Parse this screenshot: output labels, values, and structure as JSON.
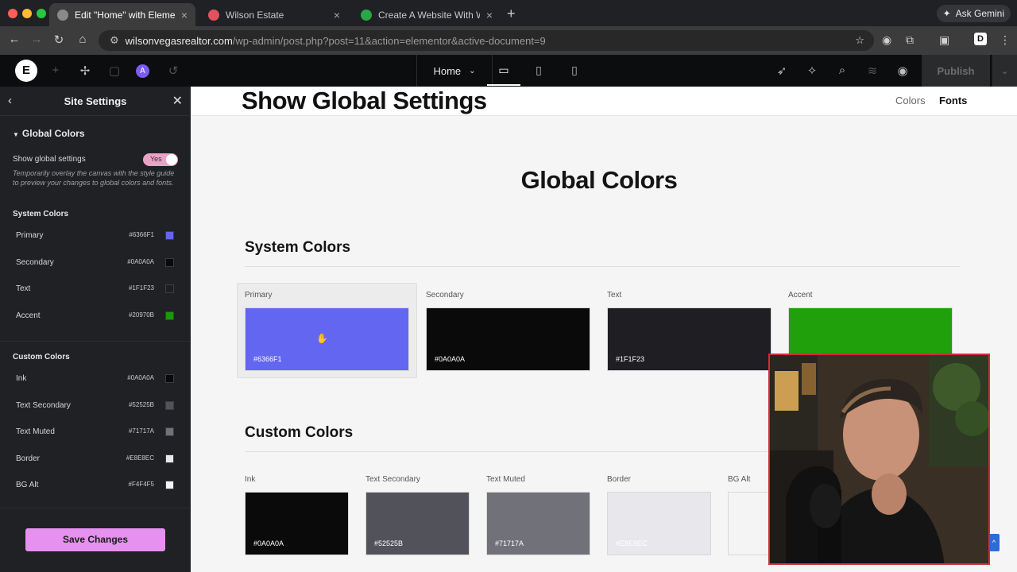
{
  "browser": {
    "tabs": [
      {
        "title": "Edit \"Home\" with Elementor",
        "active": true,
        "favicon_color": "#8a8a8a"
      },
      {
        "title": "Wilson Estate",
        "active": false,
        "favicon_color": "#e0525f"
      },
      {
        "title": "Create A Website With WordP",
        "active": false,
        "favicon_color": "#28a745"
      }
    ],
    "new_tab": "+",
    "ask_gemini": "Ask Gemini",
    "url_host": "wilsonvegasrealtor.com",
    "url_path": "/wp-admin/post.php?post=11&action=elementor&active-document=9",
    "profile_initial": "D"
  },
  "editor": {
    "page_selector": "Home",
    "publish_label": "Publish"
  },
  "panel": {
    "title": "Site Settings",
    "section": "Global Colors",
    "toggle_label": "Show global settings",
    "toggle_value": "Yes",
    "hint": "Temporarily overlay the canvas with the style guide to preview your changes to global colors and fonts.",
    "system_title": "System Colors",
    "system": [
      {
        "name": "Primary",
        "hex": "#6366F1",
        "color": "#6366F1"
      },
      {
        "name": "Secondary",
        "hex": "#0A0A0A",
        "color": "#0A0A0A"
      },
      {
        "name": "Text",
        "hex": "#1F1F23",
        "color": "#1F1F23"
      },
      {
        "name": "Accent",
        "hex": "#20970B",
        "color": "#20970B"
      }
    ],
    "custom_title": "Custom Colors",
    "custom": [
      {
        "name": "Ink",
        "hex": "#0A0A0A",
        "color": "#0A0A0A"
      },
      {
        "name": "Text Secondary",
        "hex": "#52525B",
        "color": "#52525B"
      },
      {
        "name": "Text Muted",
        "hex": "#71717A",
        "color": "#71717A"
      },
      {
        "name": "Border",
        "hex": "#E8E8EC",
        "color": "#E8E8EC"
      },
      {
        "name": "BG Alt",
        "hex": "#F4F4F5",
        "color": "#F4F4F5"
      }
    ],
    "save_label": "Save Changes"
  },
  "canvas": {
    "header_title": "Show Global Settings",
    "link_colors": "Colors",
    "link_fonts": "Fonts",
    "heading": "Global Colors",
    "system_heading": "System Colors",
    "system_cards": [
      {
        "label": "Primary",
        "hex": "#6366F1",
        "color": "#6366F1",
        "text_color": "#ffffff"
      },
      {
        "label": "Secondary",
        "hex": "#0A0A0A",
        "color": "#0A0A0A",
        "text_color": "#ffffff"
      },
      {
        "label": "Text",
        "hex": "#1F1F23",
        "color": "#1F1F23",
        "text_color": "#ffffff"
      },
      {
        "label": "Accent",
        "hex": "",
        "color": "#20A00B",
        "text_color": "#ffffff"
      }
    ],
    "custom_heading": "Custom Colors",
    "custom_cards": [
      {
        "label": "Ink",
        "hex": "#0A0A0A",
        "color": "#0A0A0A",
        "text_color": "#ffffff"
      },
      {
        "label": "Text Secondary",
        "hex": "#52525B",
        "color": "#52525B",
        "text_color": "#ffffff"
      },
      {
        "label": "Text Muted",
        "hex": "#71717A",
        "color": "#71717A",
        "text_color": "#ffffff"
      },
      {
        "label": "Border",
        "hex": "#E8E8EC",
        "color": "#E8E8EC",
        "text_color": "#ffffff"
      },
      {
        "label": "BG Alt",
        "hex": "",
        "color": "#F4F4F5",
        "text_color": "#ffffff"
      }
    ]
  }
}
